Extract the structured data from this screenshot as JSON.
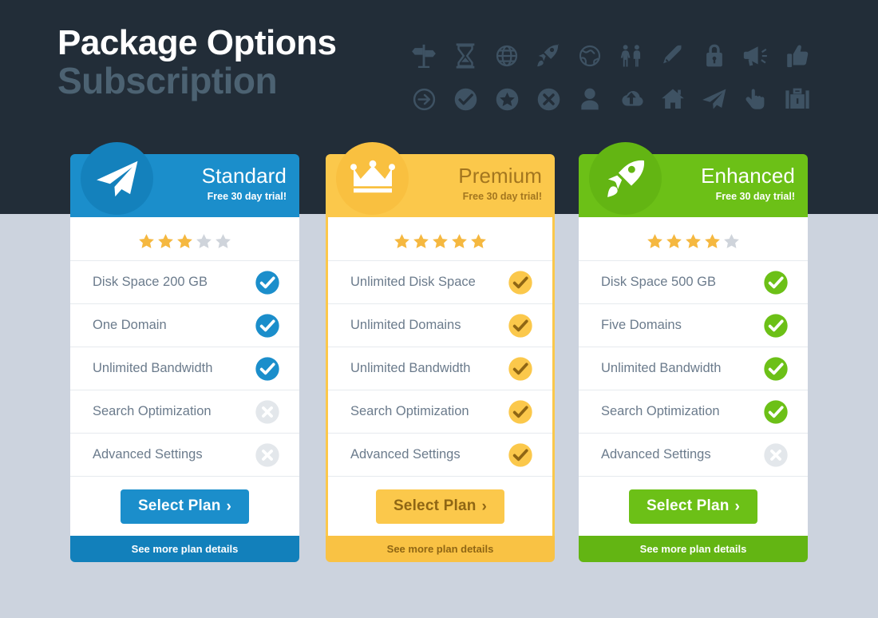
{
  "header": {
    "title_main": "Package Options",
    "title_sub": "Subscription",
    "decor_icons": [
      "signpost-icon",
      "hourglass-icon",
      "globe-grid-icon",
      "rocket-icon",
      "earth-icon",
      "restroom-people-icon",
      "pen-icon",
      "lock-icon",
      "megaphone-icon",
      "thumbs-up-icon",
      "arrow-right-circle-icon",
      "check-circle-icon",
      "star-circle-icon",
      "x-circle-icon",
      "user-icon",
      "cloud-upload-icon",
      "home-icon",
      "paper-plane-icon",
      "pointing-hand-icon",
      "briefcase-icon"
    ]
  },
  "colors": {
    "page_background": "#ccd3de",
    "header_band": "#222d38",
    "title_main": "#ffffff",
    "title_sub": "#4c6272",
    "blue": "#1b8ecb",
    "yellow": "#fbc84b",
    "yellow_text": "#a3761f",
    "green": "#6cc017",
    "star_gold": "#f5b840",
    "star_gray": "#cfd4db",
    "feature_text": "#6b7b8c",
    "disabled_icon": "#e3e7eb"
  },
  "plans": [
    {
      "id": "standard",
      "name": "Standard",
      "trial": "Free 30 day trial!",
      "badge_icon": "paper-plane-icon",
      "theme": "theme-blue",
      "rating": 3,
      "rating_max": 5,
      "features": [
        {
          "label": "Disk Space 200 GB",
          "included": true
        },
        {
          "label": "One Domain",
          "included": true
        },
        {
          "label": "Unlimited Bandwidth",
          "included": true
        },
        {
          "label": "Search Optimization",
          "included": false
        },
        {
          "label": "Advanced Settings",
          "included": false
        }
      ],
      "cta_label": "Select Plan",
      "cta_chevron": "›",
      "footer_label": "See more plan details"
    },
    {
      "id": "premium",
      "name": "Premium",
      "trial": "Free 30 day trial!",
      "badge_icon": "crown-icon",
      "theme": "theme-yellow",
      "rating": 5,
      "rating_max": 5,
      "features": [
        {
          "label": "Unlimited Disk Space",
          "included": true
        },
        {
          "label": "Unlimited Domains",
          "included": true
        },
        {
          "label": "Unlimited Bandwidth",
          "included": true
        },
        {
          "label": "Search Optimization",
          "included": true
        },
        {
          "label": "Advanced Settings",
          "included": true
        }
      ],
      "cta_label": "Select Plan",
      "cta_chevron": "›",
      "footer_label": "See more plan details"
    },
    {
      "id": "enhanced",
      "name": "Enhanced",
      "trial": "Free 30 day trial!",
      "badge_icon": "rocket-icon",
      "theme": "theme-green",
      "rating": 4,
      "rating_max": 5,
      "features": [
        {
          "label": "Disk Space 500 GB",
          "included": true
        },
        {
          "label": "Five Domains",
          "included": true
        },
        {
          "label": "Unlimited Bandwidth",
          "included": true
        },
        {
          "label": "Search Optimization",
          "included": true
        },
        {
          "label": "Advanced Settings",
          "included": false
        }
      ],
      "cta_label": "Select Plan",
      "cta_chevron": "›",
      "footer_label": "See more plan details"
    }
  ]
}
